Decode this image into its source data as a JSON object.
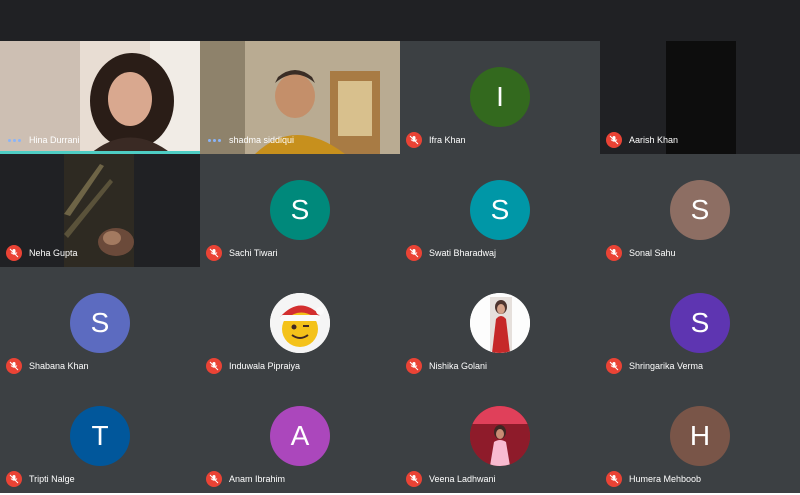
{
  "participants": [
    {
      "name": "Hina Durrani",
      "type": "video",
      "muted": false,
      "speaking": true
    },
    {
      "name": "shadma siddiqui",
      "type": "video",
      "muted": false
    },
    {
      "name": "Ifra Khan",
      "type": "avatar",
      "initial": "I",
      "color": "#33691e",
      "muted": true
    },
    {
      "name": "Aarish Khan",
      "type": "video-dark",
      "muted": true
    },
    {
      "name": "Neha Gupta",
      "type": "video",
      "muted": true
    },
    {
      "name": "Sachi Tiwari",
      "type": "avatar",
      "initial": "S",
      "color": "#00897b",
      "muted": true
    },
    {
      "name": "Swati Bharadwaj",
      "type": "avatar",
      "initial": "S",
      "color": "#0097a7",
      "muted": true
    },
    {
      "name": "Sonal Sahu",
      "type": "avatar",
      "initial": "S",
      "color": "#8d6e63",
      "muted": true
    },
    {
      "name": "Shabana Khan",
      "type": "avatar",
      "initial": "S",
      "color": "#5c6bc0",
      "muted": true
    },
    {
      "name": "Induwala Pipraiya",
      "type": "photo-avatar",
      "icon": "santa-emoji-avatar-icon",
      "muted": true
    },
    {
      "name": "Nishika Golani",
      "type": "photo-avatar",
      "icon": "profile-photo-icon",
      "muted": true
    },
    {
      "name": "Shringarika Verma",
      "type": "avatar",
      "initial": "S",
      "color": "#5e35b1",
      "muted": true
    },
    {
      "name": "Tripti Nalge",
      "type": "avatar",
      "initial": "T",
      "color": "#01579b",
      "muted": true
    },
    {
      "name": "Anam Ibrahim",
      "type": "avatar",
      "initial": "A",
      "color": "#ab47bc",
      "muted": true
    },
    {
      "name": "Veena Ladhwani",
      "type": "photo-avatar",
      "icon": "profile-photo-icon",
      "muted": true
    },
    {
      "name": "Humera Mehboob",
      "type": "avatar",
      "initial": "H",
      "color": "#795548",
      "muted": true
    }
  ],
  "icons": {
    "muted": "mic-off-icon",
    "speaking": "audio-activity-icon"
  },
  "colors": {
    "background": "#202124",
    "muted_badge": "#ea4335",
    "speaking_indicator": "#4ecdc4"
  }
}
